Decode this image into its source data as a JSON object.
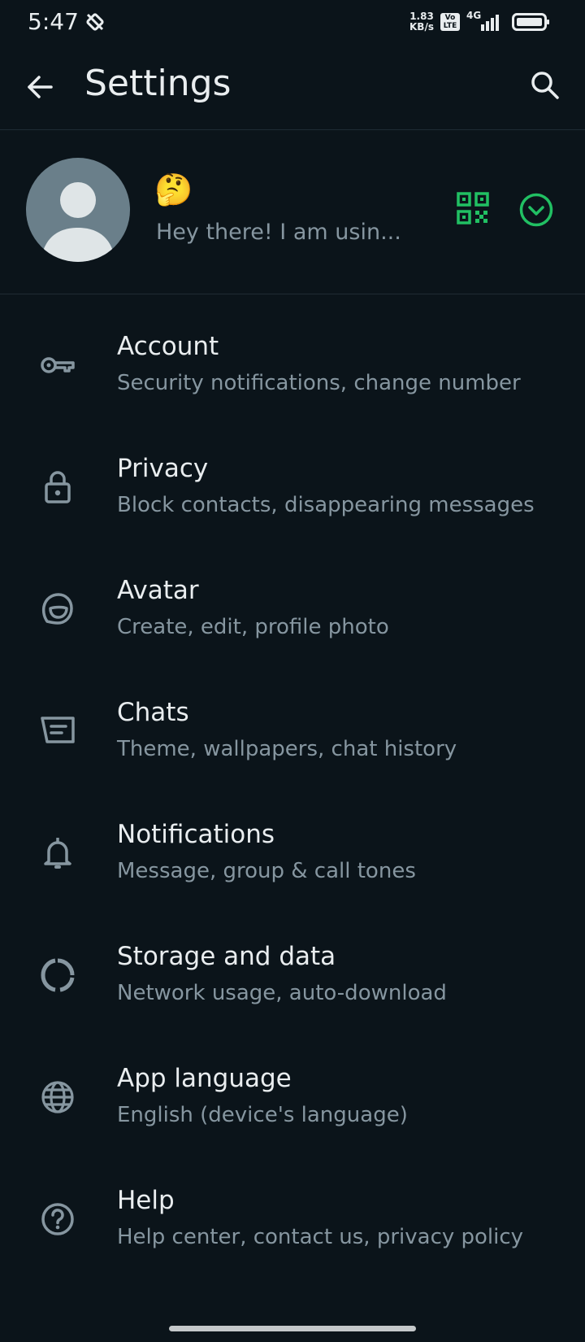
{
  "status_bar": {
    "time": "5:47",
    "speed_value": "1.83",
    "speed_unit": "KB/s",
    "volte_top": "Vo",
    "volte_bottom": "LTE",
    "network": "4G"
  },
  "header": {
    "title": "Settings",
    "back_icon": "arrow-left-icon",
    "search_icon": "search-icon"
  },
  "profile": {
    "name_emoji": "🤔",
    "status": "Hey there! I am usin...",
    "qr_icon": "qr-code-icon",
    "expand_icon": "chevron-down-circle-icon",
    "accent_color": "#21c063"
  },
  "settings_items": [
    {
      "title": "Account",
      "subtitle": "Security notifications, change number",
      "icon": "key-icon"
    },
    {
      "title": "Privacy",
      "subtitle": "Block contacts, disappearing messages",
      "icon": "lock-icon"
    },
    {
      "title": "Avatar",
      "subtitle": "Create, edit, profile photo",
      "icon": "avatar-icon"
    },
    {
      "title": "Chats",
      "subtitle": "Theme, wallpapers, chat history",
      "icon": "chat-icon"
    },
    {
      "title": "Notifications",
      "subtitle": "Message, group & call tones",
      "icon": "bell-icon"
    },
    {
      "title": "Storage and data",
      "subtitle": "Network usage, auto-download",
      "icon": "storage-icon"
    },
    {
      "title": "App language",
      "subtitle": "English (device's language)",
      "icon": "globe-icon"
    },
    {
      "title": "Help",
      "subtitle": "Help center, contact us, privacy policy",
      "icon": "help-icon"
    }
  ],
  "colors": {
    "background": "#0b141a",
    "primary_text": "#e9edef",
    "secondary_text": "#8696a0",
    "icon": "#8696a0",
    "accent": "#21c063"
  }
}
